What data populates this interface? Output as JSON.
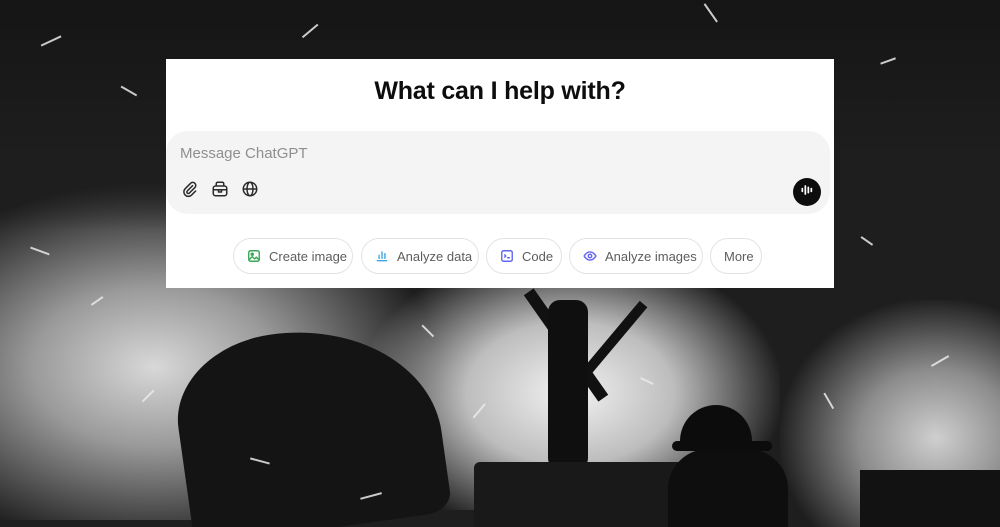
{
  "prompt": {
    "headline": "What can I help with?",
    "placeholder": "Message ChatGPT",
    "tools": [
      {
        "icon": "paperclip-icon",
        "action": "attach"
      },
      {
        "icon": "toolbox-icon",
        "action": "tools"
      },
      {
        "icon": "globe-icon",
        "action": "search-web"
      }
    ],
    "voice_icon": "voice-waveform-icon"
  },
  "suggestions": [
    {
      "label": "Create image",
      "icon": "image-icon",
      "color": "#3aa757"
    },
    {
      "label": "Analyze data",
      "icon": "bar-chart-icon",
      "color": "#3ba7e6"
    },
    {
      "label": "Code",
      "icon": "code-icon",
      "color": "#6366f1"
    },
    {
      "label": "Analyze images",
      "icon": "eye-icon",
      "color": "#6366f1"
    },
    {
      "label": "More",
      "icon": "",
      "color": "#5d5d5d"
    }
  ],
  "colors": {
    "panel_bg": "#ffffff",
    "composer_bg": "#f4f4f4",
    "voice_button_bg": "#0d0d0d",
    "headline": "#0d0d0d"
  }
}
